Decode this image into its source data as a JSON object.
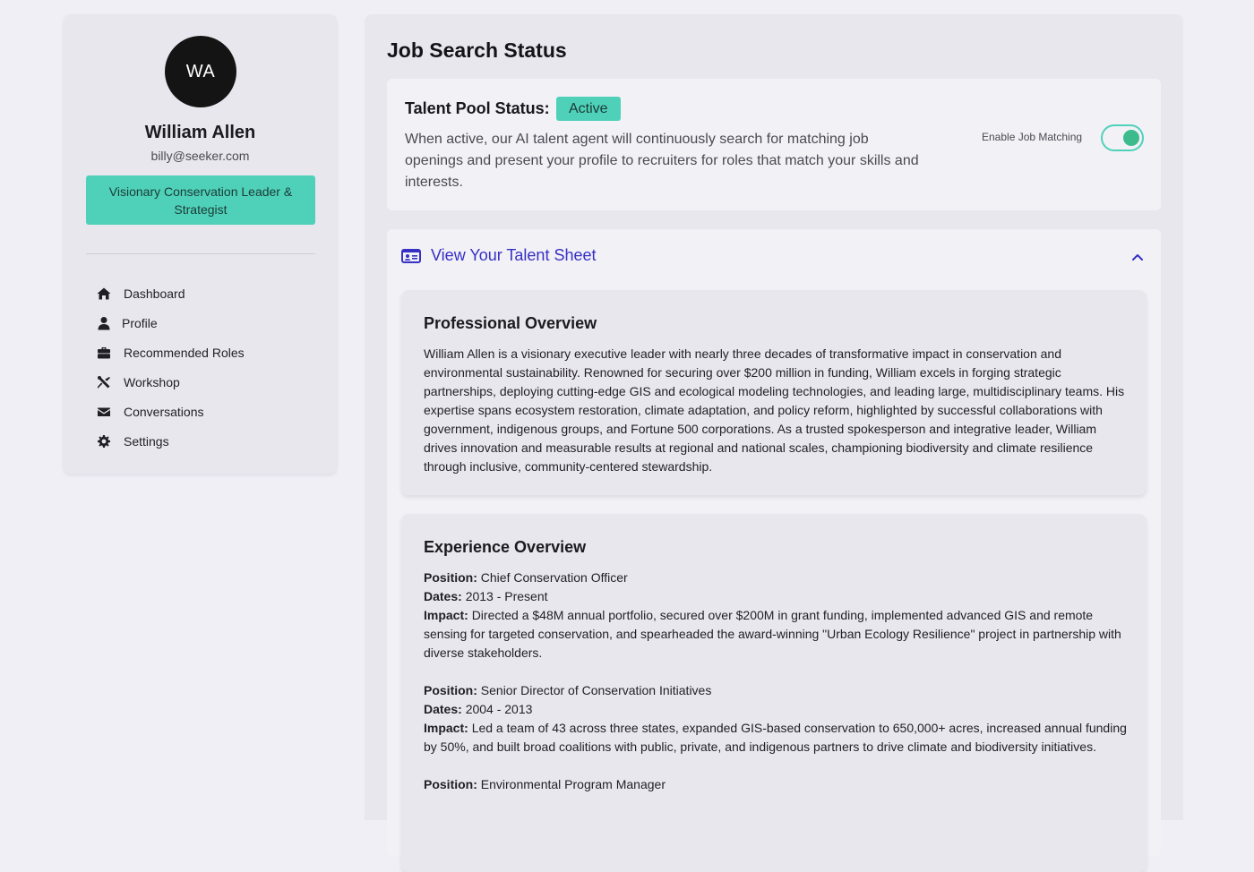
{
  "user": {
    "initials": "WA",
    "name": "William Allen",
    "email": "billy@seeker.com",
    "headline": "Visionary Conservation Leader & Strategist"
  },
  "nav": {
    "items": [
      {
        "label": "Dashboard",
        "icon": "home-icon"
      },
      {
        "label": "Profile",
        "icon": "user-icon"
      },
      {
        "label": "Recommended Roles",
        "icon": "briefcase-icon"
      },
      {
        "label": "Workshop",
        "icon": "tools-icon"
      },
      {
        "label": "Conversations",
        "icon": "envelope-icon"
      },
      {
        "label": "Settings",
        "icon": "gear-icon"
      }
    ]
  },
  "main": {
    "title": "Job Search Status",
    "status": {
      "label": "Talent Pool Status:",
      "badge": "Active",
      "description": "When active, our AI talent agent will continuously search for matching job openings and present your profile to recruiters for roles that match your skills and interests.",
      "toggle_label": "Enable Job Matching",
      "toggle_on": true
    },
    "talent_sheet": {
      "title": "View Your Talent Sheet",
      "expanded": true,
      "overview": {
        "title": "Professional Overview",
        "text": "William Allen is a visionary executive leader with nearly three decades of transformative impact in conservation and environmental sustainability. Renowned for securing over $200 million in funding, William excels in forging strategic partnerships, deploying cutting-edge GIS and ecological modeling technologies, and leading large, multidisciplinary teams. His expertise spans ecosystem restoration, climate adaptation, and policy reform, highlighted by successful collaborations with government, indigenous groups, and Fortune 500 corporations. As a trusted spokesperson and integrative leader, William drives innovation and measurable results at regional and national scales, championing biodiversity and climate resilience through inclusive, community-centered stewardship."
      },
      "experience": {
        "title": "Experience Overview",
        "position_label": "Position:",
        "dates_label": "Dates:",
        "impact_label": "Impact:",
        "entries": [
          {
            "position": "Chief Conservation Officer",
            "dates": "2013 - Present",
            "impact": "Directed a $48M annual portfolio, secured over $200M in grant funding, implemented advanced GIS and remote sensing for targeted conservation, and spearheaded the award-winning \"Urban Ecology Resilience\" project in partnership with diverse stakeholders."
          },
          {
            "position": "Senior Director of Conservation Initiatives",
            "dates": "2004 - 2013",
            "impact": "Led a team of 43 across three states, expanded GIS-based conservation to 650,000+ acres, increased annual funding by 50%, and built broad coalitions with public, private, and indigenous partners to drive climate and biodiversity initiatives."
          },
          {
            "position": "Environmental Program Manager"
          }
        ]
      }
    }
  },
  "colors": {
    "accent_teal": "#4fd1b9",
    "link_blue": "#3730c4",
    "toggle_knob": "#3dbb8c"
  }
}
